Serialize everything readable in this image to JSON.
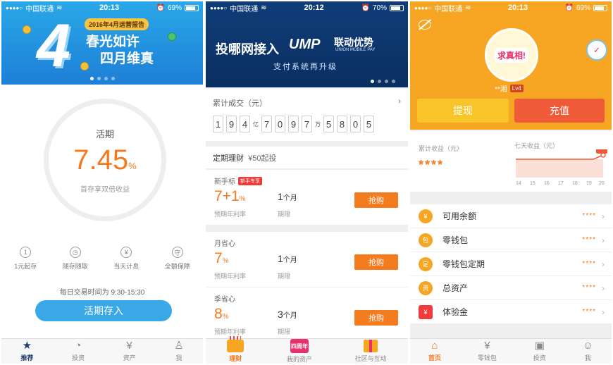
{
  "s1": {
    "status": {
      "carrier": "中国联通",
      "time": "20:13",
      "battery": "69%"
    },
    "banner": {
      "number": "4",
      "badge": "2016年4月运营报告",
      "line1": "春光如许",
      "line2": "四月维真"
    },
    "product": {
      "label": "活期",
      "rate": "7.45",
      "rate_unit": "%",
      "subtitle": "首存享双倍收益"
    },
    "features": [
      {
        "icon": "1",
        "label": "1元起存"
      },
      {
        "icon": "◷",
        "label": "随存随取"
      },
      {
        "icon": "¥",
        "label": "当天计息"
      },
      {
        "icon": "守",
        "label": "全额保障"
      }
    ],
    "hours": "每日交易时间为 9:30-15:30",
    "deposit_button": "活期存入",
    "tabs": [
      {
        "icon": "★",
        "label": "推荐"
      },
      {
        "icon": "◔",
        "label": "投资"
      },
      {
        "icon": "¥",
        "label": "资产"
      },
      {
        "icon": "♙",
        "label": "我"
      }
    ]
  },
  "s2": {
    "status": {
      "carrier": "中国联通",
      "time": "20:12",
      "battery": "70%"
    },
    "banner": {
      "text": "投哪网接入",
      "logo": "UMP",
      "logo_cn": "联动优势",
      "logo_en": "UNION MOBILE PAY",
      "sub": "支付系统再升级"
    },
    "accum": {
      "title": "累计成交（元）",
      "digits": [
        "1",
        "9",
        "4",
        "亿",
        "7",
        "0",
        "9",
        "7",
        "万",
        "5",
        "8",
        "0",
        "5"
      ]
    },
    "fixed": {
      "title": "定期理财",
      "note": "¥50起投"
    },
    "products": [
      {
        "name": "新手标",
        "tag": "新手专享",
        "rate": "7+1",
        "rate_unit": "%",
        "rate_label": "预期年利率",
        "period": "1",
        "period_unit": "个月",
        "period_label": "期限",
        "buy": "抢购"
      },
      {
        "name": "月省心",
        "tag": "",
        "rate": "7",
        "rate_unit": "%",
        "rate_label": "预期年利率",
        "period": "1",
        "period_unit": "个月",
        "period_label": "期限",
        "buy": "抢购"
      },
      {
        "name": "季省心",
        "tag": "",
        "rate": "8",
        "rate_unit": "%",
        "rate_label": "预期年利率",
        "period": "3",
        "period_unit": "个月",
        "period_label": "期限",
        "buy": "抢购"
      }
    ],
    "tabs": [
      {
        "icon": "",
        "label": "理财"
      },
      {
        "icon": "四周年",
        "label": "我的资产"
      },
      {
        "icon": "",
        "label": "社区与互动"
      }
    ]
  },
  "s3": {
    "status": {
      "carrier": "中国联通",
      "time": "20:13",
      "battery": "69%"
    },
    "avatar_text": "求真相!",
    "username": "**湘",
    "level": "Lv4",
    "withdraw": "提现",
    "recharge": "充值",
    "earnings": {
      "label": "累计收益（元）",
      "value": "****",
      "chart_label": "七天收益（元）",
      "days": [
        "14",
        "15",
        "16",
        "17",
        "18",
        "19",
        "20"
      ],
      "tip": "····"
    },
    "menu": [
      {
        "icon": "¥",
        "label": "可用余额",
        "value": "****"
      },
      {
        "icon": "包",
        "label": "零钱包",
        "value": "****"
      },
      {
        "icon": "定",
        "label": "零钱包定期",
        "value": "****"
      },
      {
        "icon": "资",
        "label": "总资产",
        "value": "****"
      },
      {
        "icon": "¥",
        "label": "体验金",
        "value": "****"
      }
    ],
    "tabs": [
      {
        "icon": "⌂",
        "label": "首页"
      },
      {
        "icon": "¥",
        "label": "零钱包"
      },
      {
        "icon": "▣",
        "label": "投资"
      },
      {
        "icon": "☺",
        "label": "我"
      }
    ]
  },
  "colors": {
    "orange": "#f47a20",
    "blue": "#3aa8e6",
    "navy": "#0f3d78",
    "amber": "#f6a623"
  }
}
